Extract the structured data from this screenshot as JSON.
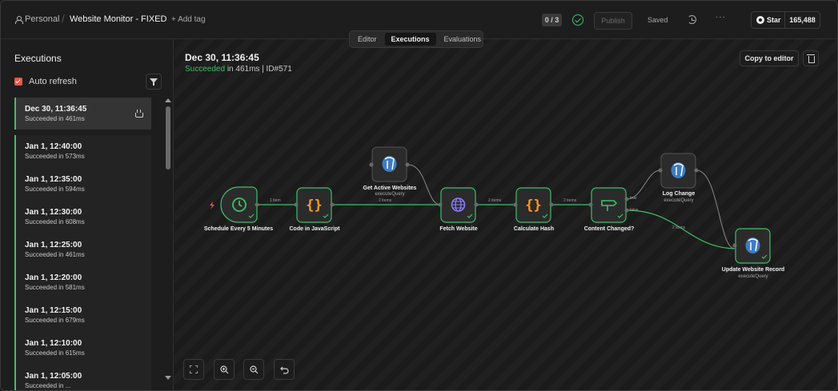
{
  "header": {
    "workspace": "Personal",
    "workflow_name": "Website Monitor - FIXED",
    "add_tag": "+ Add tag",
    "counter": "0 / 3",
    "publish": "Publish",
    "saved": "Saved",
    "more": "···",
    "github_star": "Star",
    "github_count": "165,488"
  },
  "tabs": [
    "Editor",
    "Executions",
    "Evaluations"
  ],
  "active_tab": "Executions",
  "sidebar": {
    "title": "Executions",
    "auto_refresh_label": "Auto refresh",
    "auto_refresh_checked": true,
    "executions": [
      {
        "time": "Dec 30, 11:36:45",
        "status": "Succeeded in 461ms",
        "selected": true
      },
      {
        "time": "Jan 1, 12:40:00",
        "status": "Succeeded in 573ms"
      },
      {
        "time": "Jan 1, 12:35:00",
        "status": "Succeeded in 594ms"
      },
      {
        "time": "Jan 1, 12:30:00",
        "status": "Succeeded in 608ms"
      },
      {
        "time": "Jan 1, 12:25:00",
        "status": "Succeeded in 461ms"
      },
      {
        "time": "Jan 1, 12:20:00",
        "status": "Succeeded in 581ms"
      },
      {
        "time": "Jan 1, 12:15:00",
        "status": "Succeeded in 679ms"
      },
      {
        "time": "Jan 1, 12:10:00",
        "status": "Succeeded in 615ms"
      },
      {
        "time": "Jan 1, 12:05:00",
        "status": "Succeeded in ..."
      }
    ]
  },
  "canvas": {
    "exec_date": "Dec 30, 11:36:45",
    "status_ok": "Succeeded",
    "status_rest": " in 461ms | ID#571",
    "copy_to_editor": "Copy to editor"
  },
  "nodes": [
    {
      "id": "schedule",
      "label": "Schedule Every 5 Minutes",
      "sub": ""
    },
    {
      "id": "code",
      "label": "Code in JavaScript",
      "sub": ""
    },
    {
      "id": "get_active",
      "label": "Get Active Websites",
      "sub": "executeQuery"
    },
    {
      "id": "fetch",
      "label": "Fetch Website",
      "sub": ""
    },
    {
      "id": "hash",
      "label": "Calculate Hash",
      "sub": ""
    },
    {
      "id": "changed",
      "label": "Content Changed?",
      "sub": ""
    },
    {
      "id": "log",
      "label": "Log Change",
      "sub": "executeQuery"
    },
    {
      "id": "update",
      "label": "Update Website Record",
      "sub": "executeQuery"
    }
  ],
  "edge_labels": {
    "schedule_code": "1 item",
    "code_fetch": "2 items",
    "fetch_hash": "2 items",
    "hash_changed": "2 items",
    "changed_true": "true",
    "changed_false": "false",
    "false_update": "2 items"
  },
  "colors": {
    "success": "#3fbf6a",
    "accent_checkbox": "#e8564a",
    "node_bg": "#2b2b2b",
    "code_orange": "#ff9b26",
    "globe_purple": "#8b7cf6"
  },
  "zoom_controls": [
    "fit-view",
    "zoom-in",
    "zoom-out",
    "reset-zoom"
  ]
}
